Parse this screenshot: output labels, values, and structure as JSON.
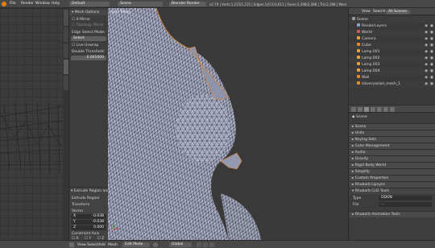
{
  "top_bar": {
    "menus": [
      "File",
      "Render",
      "Window",
      "Help"
    ],
    "layout": "Default",
    "scene": "Scene",
    "engine": "Blender Render",
    "info": "v2.79 | Verts:1,215/1,215 | Edges:3,611/3,611 | Faces:2,398/2,398 | Tris:2,398 | Mem:83.69M | slaveryasian_mesh_1"
  },
  "left_panel": {
    "tabs": [
      "Tools",
      "Create",
      "Relations",
      "Animation",
      "Physics",
      "Grease Pencil"
    ],
    "header": "Mesh Options",
    "options": [
      "X-Mirror",
      "Topology Mirror"
    ],
    "edge_label": "Edge Select Mode:",
    "edge_mode": "Select",
    "limit_label": "Live Unwrap",
    "double_threshold_label": "Double Threshold:",
    "double_threshold": "0.001000"
  },
  "operator_panel": {
    "title": "Extrude Region and Mo...",
    "extrude_label": "Extrude Region",
    "transform": "Transform",
    "vector_label": "Vector",
    "vector": [
      {
        "axis": "X",
        "value": "-0.038"
      },
      {
        "axis": "Y",
        "value": "-0.038"
      },
      {
        "axis": "Z",
        "value": "0.000"
      }
    ],
    "constraint_label": "Constraint Axis",
    "constraint_axes": [
      "X",
      "Y",
      "Z"
    ]
  },
  "viewport": {
    "label": "User Persp",
    "footer": [
      "View",
      "Select",
      "Add",
      "Mesh"
    ],
    "mode": "Edit Mode",
    "shading": "Global"
  },
  "outliner": {
    "tabs": [
      "View",
      "Search",
      "All Scenes"
    ],
    "items": [
      {
        "name": "Scene",
        "indent": 0,
        "color": "#9a9a9a"
      },
      {
        "name": "RenderLayers",
        "indent": 1,
        "color": "#8da0c8"
      },
      {
        "name": "World",
        "indent": 1,
        "color": "#c45a5a"
      },
      {
        "name": "Camera",
        "indent": 1,
        "color": "#e0a040"
      },
      {
        "name": "Cube",
        "indent": 1,
        "color": "#e08a30"
      },
      {
        "name": "Lamp.001",
        "indent": 1,
        "color": "#e0a040"
      },
      {
        "name": "Lamp.002",
        "indent": 1,
        "color": "#e0a040"
      },
      {
        "name": "Lamp.003",
        "indent": 1,
        "color": "#e0a040"
      },
      {
        "name": "Lamp.004",
        "indent": 1,
        "color": "#e0a040"
      },
      {
        "name": "Wall",
        "indent": 1,
        "color": "#e08a30"
      },
      {
        "name": "slaveryasian_mesh_1",
        "indent": 1,
        "color": "#e08a30"
      }
    ]
  },
  "properties": {
    "breadcrumb": "Scene",
    "sections": [
      "Scene",
      "Units",
      "Keying Sets",
      "Color Management",
      "Audio",
      "Gravity",
      "Rigid Body World",
      "Simplify",
      "Custom Properties",
      "Rhubarb Lipsync",
      "Rhubarb CLD Tools"
    ],
    "type_label": "Type",
    "type_value": "ODON",
    "file_label": "File",
    "file_value": "...",
    "extra_section": "Rhubarb Animation Tools"
  },
  "colors": {
    "accent": "#5680c2",
    "orange": "#e08a30",
    "mesh": "#b6bbd1"
  }
}
